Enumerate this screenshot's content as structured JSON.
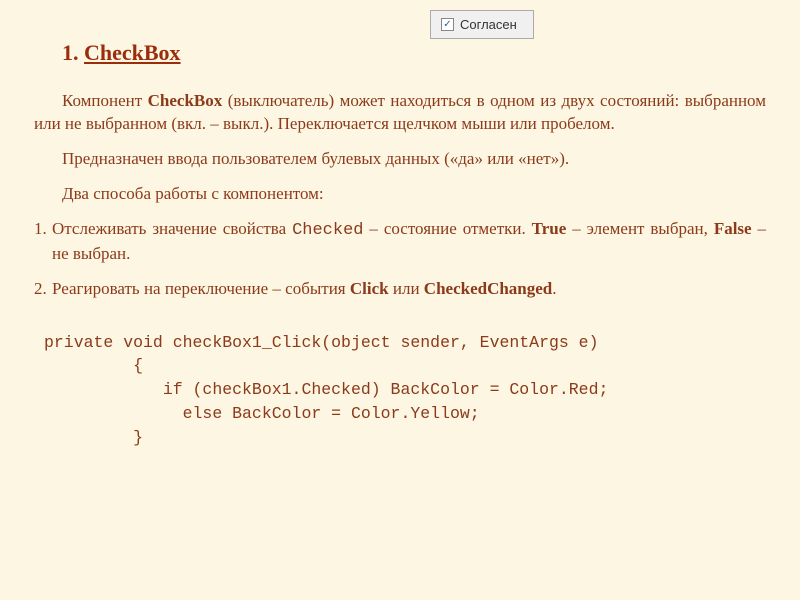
{
  "checkbox_widget": {
    "label": "Согласен",
    "checked_mark": "✓"
  },
  "heading": {
    "number": "1.",
    "title": "CheckBox"
  },
  "paragraphs": {
    "p1_prefix": "Компонент ",
    "p1_bold": "CheckBox",
    "p1_suffix": " (выключатель) может находиться в одном из двух состояний: выбранном или не выбранном (вкл. – выкл.). Переключается щелчком мыши или пробелом.",
    "p2": "Предназначен ввода пользователем булевых данных («да» или «нет»).",
    "p3": "Два способа работы с компонентом:"
  },
  "list": {
    "item1_a": "Отслеживать значение свойства ",
    "item1_mono": "Checked",
    "item1_b": " – состояние отметки. ",
    "item1_true": "True",
    "item1_c": " – элемент выбран, ",
    "item1_false": "False",
    "item1_d": " – не выбран.",
    "item2_a": "Реагировать на переключение – события ",
    "item2_click": "Click",
    "item2_b": " или ",
    "item2_cc": "CheckedChanged",
    "item2_c": "."
  },
  "code": {
    "line1": "private void checkBox1_Click(object sender, EventArgs e)",
    "line2": "         {",
    "line3": "            if (checkBox1.Checked) BackColor = Color.Red;",
    "line4": "              else BackColor = Color.Yellow;",
    "line5": "         }"
  }
}
